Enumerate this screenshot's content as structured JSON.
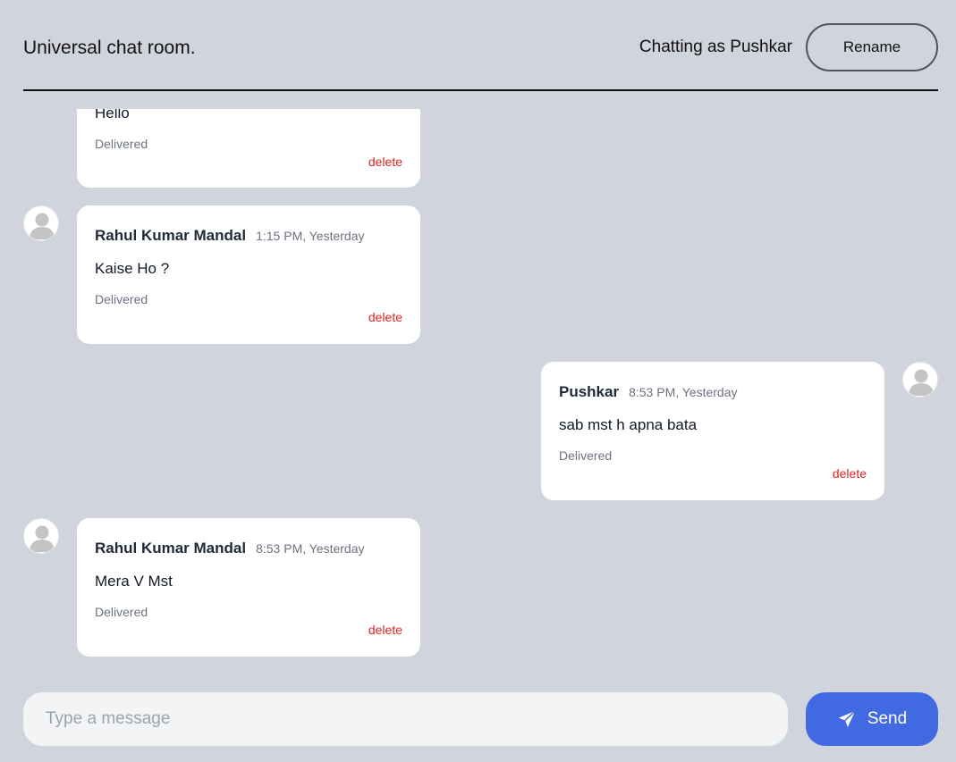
{
  "header": {
    "room_title": "Universal chat room.",
    "chatting_as": "Chatting as Pushkar",
    "rename_label": "Rename"
  },
  "messages": [
    {
      "sender": "",
      "time": "",
      "text": "Hello",
      "status": "Delivered",
      "delete_label": "delete",
      "side": "left",
      "partial": true
    },
    {
      "sender": "Rahul Kumar Mandal",
      "time": "1:15 PM, Yesterday",
      "text": "Kaise Ho ?",
      "status": "Delivered",
      "delete_label": "delete",
      "side": "left"
    },
    {
      "sender": "Pushkar",
      "time": "8:53 PM, Yesterday",
      "text": "sab mst h apna bata",
      "status": "Delivered",
      "delete_label": "delete",
      "side": "right"
    },
    {
      "sender": "Rahul Kumar Mandal",
      "time": "8:53 PM, Yesterday",
      "text": "Mera V Mst",
      "status": "Delivered",
      "delete_label": "delete",
      "side": "left"
    }
  ],
  "composer": {
    "placeholder": "Type a message",
    "value": "",
    "send_label": "Send"
  },
  "colors": {
    "background": "#d1d4dc",
    "accent": "#4169e1",
    "delete": "#e02424"
  }
}
